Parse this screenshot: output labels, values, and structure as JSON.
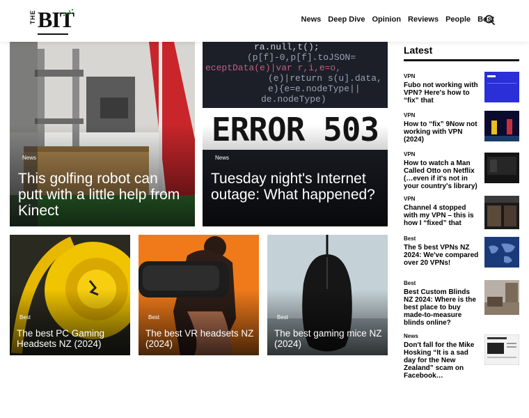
{
  "nav": [
    "News",
    "Deep Dive",
    "Opinion",
    "Reviews",
    "People",
    "Best"
  ],
  "sidebar": {
    "heading": "Latest",
    "items": [
      {
        "cat": "VPN",
        "title": "Fubo not working with VPN? Here's how to “fix” that"
      },
      {
        "cat": "VPN",
        "title": "How to “fix” 9Now not working with VPN (2024)"
      },
      {
        "cat": "VPN",
        "title": "How to watch a Man Called Otto on Netflix (…even if it's not in your country's library)"
      },
      {
        "cat": "VPN",
        "title": "Channel 4 stopped with my VPN – this is how I “fixed” that"
      },
      {
        "cat": "Best",
        "title": "The 5 best VPNs NZ 2024: We've compared over 20 VPNs!"
      },
      {
        "cat": "Best",
        "title": "Best Custom Blinds NZ 2024: Where is the best place to buy made-to-measure blinds online?"
      },
      {
        "cat": "News",
        "title": "Don't fall for the Mike Hosking “It is a sad day for the New Zealand” scam on Facebook…"
      }
    ]
  },
  "cards": [
    {
      "cat": "News",
      "title": "This golfing robot can putt with a little help from Kinect"
    },
    {
      "cat": "News",
      "title": "Tuesday night's Internet outage: What happened?"
    },
    {
      "cat": "Best",
      "title": "The best PC Gaming Headsets NZ (2024)"
    },
    {
      "cat": "Best",
      "title": "The best VR headsets NZ (2024)"
    },
    {
      "cat": "Best",
      "title": "The best gaming mice NZ (2024)"
    }
  ],
  "error_text": "ERROR 503",
  "code_lines": [
    "ra.null,t();",
    "(p[f]-0,p[f].toJSON=",
    "eceptData(e)|var r,i,e=o,",
    "(e)|return s(u].data,",
    "e){e=e.nodeType||",
    "de.nodeType)"
  ],
  "logo": {
    "the": "THE",
    "bit": "BIT"
  }
}
